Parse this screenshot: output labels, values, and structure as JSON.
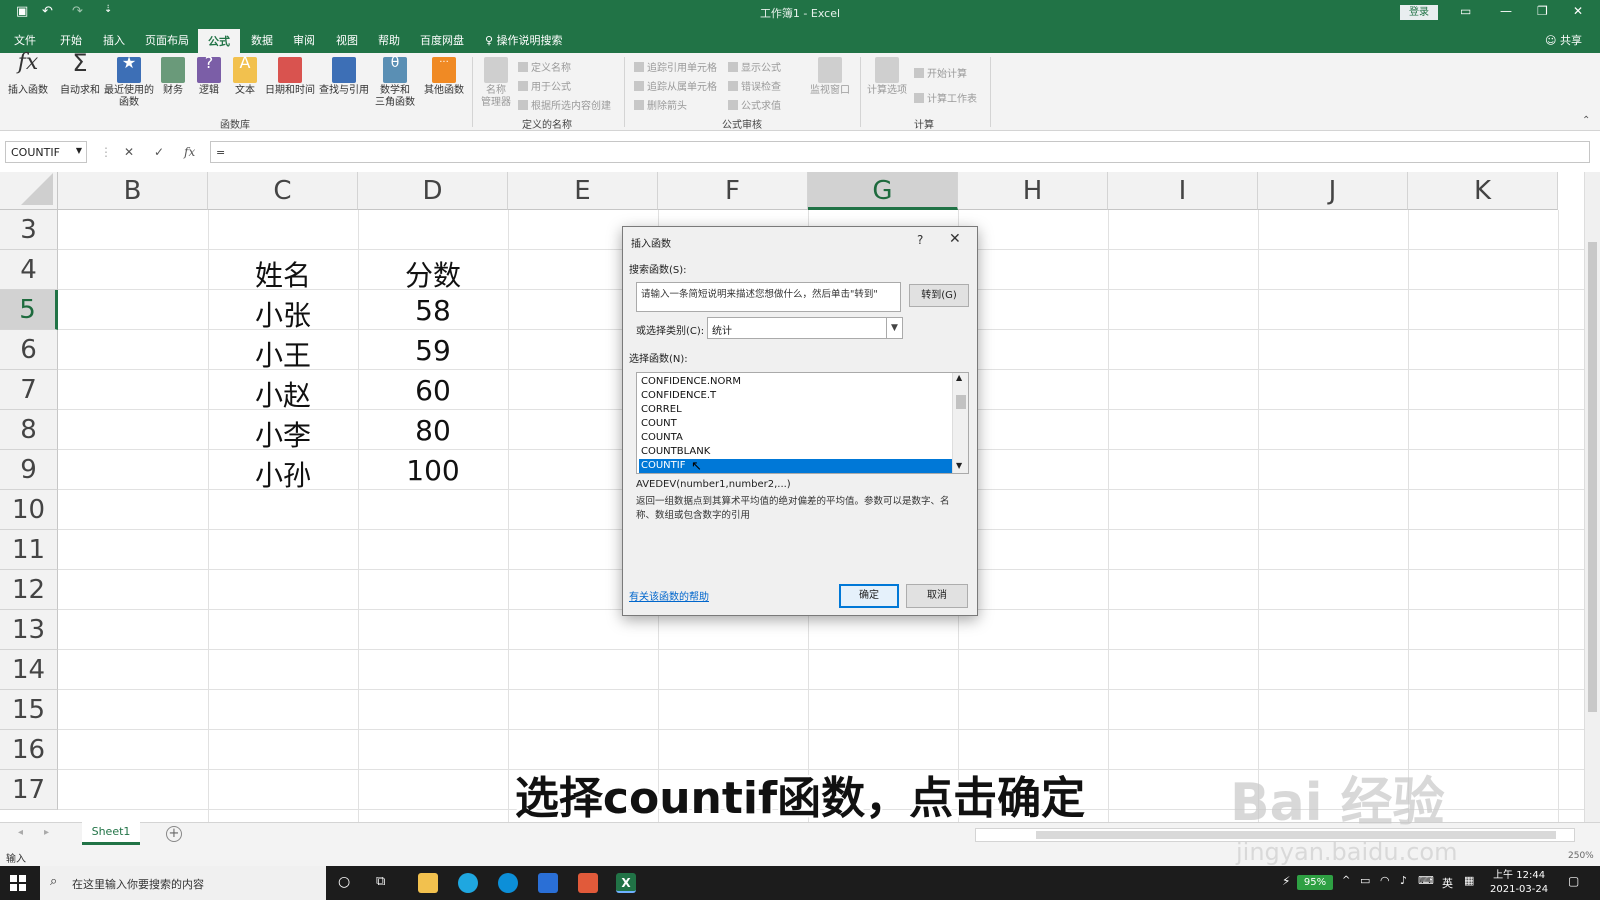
{
  "app": {
    "window_title": "工作簿1  -  Excel",
    "login": "登录",
    "share": "共享"
  },
  "ribbon_tabs": [
    "文件",
    "开始",
    "插入",
    "页面布局",
    "公式",
    "数据",
    "审阅",
    "视图",
    "帮助",
    "百度网盘",
    "操作说明搜索"
  ],
  "ribbon": {
    "buttons": [
      "插入函数",
      "自动求和",
      "最近使用的\n函数",
      "财务",
      "逻辑",
      "文本",
      "日期和时间",
      "查找与引用",
      "数学和\n三角函数",
      "其他函数",
      "名称\n管理器",
      "监视窗口",
      "计算选项"
    ],
    "defined_names": [
      "定义名称",
      "用于公式",
      "根据所选内容创建"
    ],
    "audit": [
      "追踪引用单元格",
      "追踪从属单元格",
      "删除箭头",
      "显示公式",
      "错误检查",
      "公式求值"
    ],
    "calc": [
      "开始计算",
      "计算工作表"
    ],
    "groups": [
      "函数库",
      "定义的名称",
      "公式审核",
      "计算"
    ],
    "colors": {
      "brand": "#217346",
      "ribbon_bg": "#f3f3f3"
    }
  },
  "formula_bar": {
    "name_box": "COUNTIF",
    "formula": "="
  },
  "sheet": {
    "columns": [
      "B",
      "C",
      "D",
      "E",
      "F",
      "G",
      "H",
      "I",
      "J",
      "K"
    ],
    "selected_column": "G",
    "rows": [
      "3",
      "4",
      "5",
      "6",
      "7",
      "8",
      "9",
      "10",
      "11",
      "12",
      "13",
      "14",
      "15",
      "16",
      "17"
    ],
    "selected_row": "5",
    "data": [
      {
        "name": "姓名",
        "score": "分数"
      },
      {
        "name": "小张",
        "score": "58"
      },
      {
        "name": "小王",
        "score": "59"
      },
      {
        "name": "小赵",
        "score": "60"
      },
      {
        "name": "小李",
        "score": "80"
      },
      {
        "name": "小孙",
        "score": "100"
      }
    ],
    "tab_name": "Sheet1"
  },
  "status": {
    "mode": "输入",
    "zoom": "250%"
  },
  "dialog": {
    "title": "插入函数",
    "search_label": "搜索函数(S):",
    "search_placeholder": "请输入一条简短说明来描述您想做什么，然后单击\"转到\"",
    "go_button": "转到(G)",
    "category_label": "或选择类别(C):",
    "category_value": "统计",
    "select_label": "选择函数(N):",
    "functions": [
      "CONFIDENCE.NORM",
      "CONFIDENCE.T",
      "CORREL",
      "COUNT",
      "COUNTA",
      "COUNTBLANK",
      "COUNTIF"
    ],
    "selected_function": "COUNTIF",
    "signature": "AVEDEV(number1,number2,...)",
    "description": "返回一组数据点到其算术平均值的绝对偏差的平均值。参数可以是数字、名称、数组或包含数字的引用",
    "help_link": "有关该函数的帮助",
    "ok": "确定",
    "cancel": "取消"
  },
  "taskbar": {
    "search_placeholder": "在这里输入你要搜索的内容",
    "battery": "95%",
    "ime": "英",
    "time": "上午 12:44",
    "date": "2021-03-24"
  },
  "caption": "选择countif函数，点击确定",
  "watermark": {
    "logo": "Bai 经验",
    "url": "jingyan.baidu.com"
  }
}
